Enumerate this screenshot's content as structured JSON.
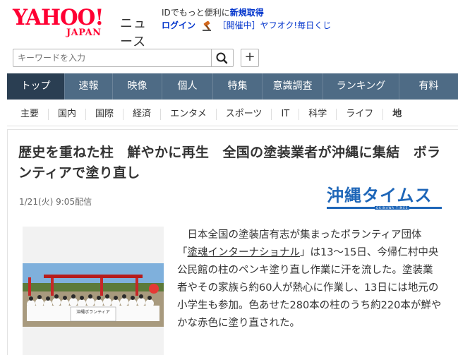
{
  "header": {
    "logo_main": "YAHOO!",
    "logo_sub": "JAPAN",
    "logo_service": "ニュース",
    "promo_line1_prefix": "IDでもっと便利に",
    "promo_line1_link": "新規取得",
    "login_label": "ログイン",
    "auction_label": "［開催中］ヤフオク!毎日くじ"
  },
  "search": {
    "placeholder": "キーワードを入力",
    "search_icon": "search-icon",
    "add_label": "+"
  },
  "mainnav": {
    "items": [
      {
        "label": "トップ"
      },
      {
        "label": "速報"
      },
      {
        "label": "映像"
      },
      {
        "label": "個人"
      },
      {
        "label": "特集"
      },
      {
        "label": "意識調査"
      },
      {
        "label": "ランキング"
      },
      {
        "label": "有料"
      }
    ]
  },
  "subnav": {
    "items": [
      {
        "label": "主要"
      },
      {
        "label": "国内"
      },
      {
        "label": "国際"
      },
      {
        "label": "経済"
      },
      {
        "label": "エンタメ"
      },
      {
        "label": "スポーツ"
      },
      {
        "label": "IT"
      },
      {
        "label": "科学"
      },
      {
        "label": "ライフ"
      },
      {
        "label": "地"
      }
    ]
  },
  "article": {
    "title": "歴史を重ねた柱　鮮やかに再生　全国の塗装業者が沖縄に集結　ボランティアで塗り直し",
    "date": "1/21(火) 9:05配信",
    "source_name": "沖縄タイムス",
    "source_sub": "OKINAWA TIMES",
    "body_before_link": "日本全国の塗装店有志が集まったボランティア団体「",
    "body_link": "塗魂インターナショナル",
    "body_after_link": "」は13～15日、今帰仁村中央公民館の柱のペンキ塗り直し作業に汗を流した。塗装業者やその家族ら約60人が熱心に作業し、13日には地元の小学生も参加。色あせた280本の柱のうち約220本が鮮やかな赤色に塗り直された。",
    "banner_text": "沖縄ボランティア"
  },
  "colors": {
    "brand_red": "#ff0033",
    "nav_bg": "#4e6b85",
    "nav_active": "#2a3e52",
    "link_blue": "#0033cc",
    "source_blue": "#1e66b8"
  }
}
